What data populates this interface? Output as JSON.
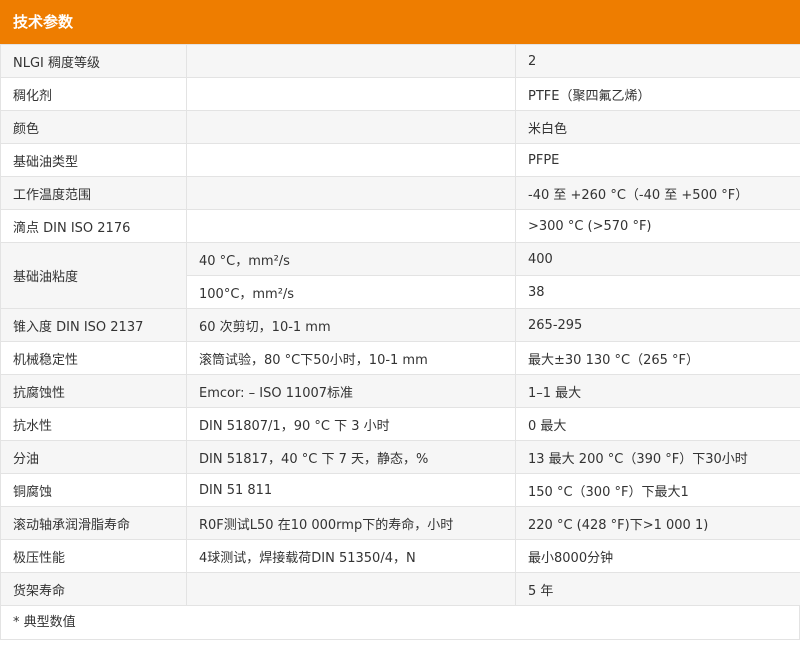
{
  "header": {
    "title": "技术参数"
  },
  "rows": [
    {
      "param": "NLGI 稠度等级",
      "condition": "",
      "value": "2"
    },
    {
      "param": "稠化剂",
      "condition": "",
      "value": "PTFE（聚四氟乙烯）"
    },
    {
      "param": "颜色",
      "condition": "",
      "value": "米白色"
    },
    {
      "param": "基础油类型",
      "condition": "",
      "value": "PFPE"
    },
    {
      "param": "工作温度范围",
      "condition": "",
      "value": "-40 至 +260 °C（-40 至 +500 °F）"
    },
    {
      "param": "滴点 DIN ISO 2176",
      "condition": "",
      "value": ">300 °C (>570 °F)"
    },
    {
      "param": "基础油粘度",
      "condition": "40 °C，mm²/s",
      "value": "400"
    },
    {
      "param": "",
      "condition": "100°C，mm²/s",
      "value": "38"
    },
    {
      "param": "锥入度 DIN ISO 2137",
      "condition": "60 次剪切，10-1 mm",
      "value": "265-295"
    },
    {
      "param": "机械稳定性",
      "condition": "滚筒试验，80 °C下50小时，10-1 mm",
      "value": "最大±30 130 °C（265 °F）"
    },
    {
      "param": "抗腐蚀性",
      "condition": "Emcor: – ISO 11007标准",
      "value": "1–1 最大"
    },
    {
      "param": "抗水性",
      "condition": "DIN 51807/1，90 °C 下 3 小时",
      "value": "0 最大"
    },
    {
      "param": "分油",
      "condition": "DIN 51817，40 °C 下 7 天，静态，%",
      "value": "13 最大 200 °C（390 °F）下30小时"
    },
    {
      "param": "铜腐蚀",
      "condition": "DIN 51 811",
      "value": "150 °C（300 °F）下最大1"
    },
    {
      "param": "滚动轴承润滑脂寿命",
      "condition": "R0F测试L50 在10 000rmp下的寿命，小时",
      "value": "220 °C (428 °F)下>1 000 1)"
    },
    {
      "param": "极压性能",
      "condition": "4球测试，焊接载荷DIN 51350/4，N",
      "value": "最小8000分钟"
    },
    {
      "param": "货架寿命",
      "condition": "",
      "value": "5 年"
    }
  ],
  "footnote": "* 典型数值",
  "colors": {
    "header_bg": "#ee7d00",
    "header_text": "#ffffff",
    "stripe": "#f6f6f6",
    "border": "#e3e3e3"
  }
}
